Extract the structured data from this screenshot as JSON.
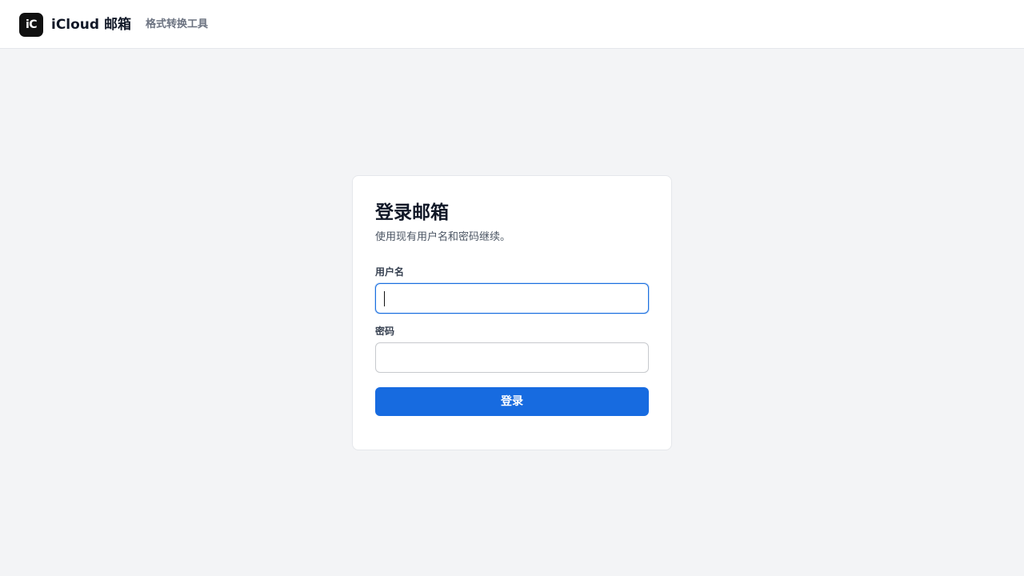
{
  "header": {
    "logo_text": "iC",
    "app_title": "iCloud 邮箱",
    "nav_link": "格式转换工具"
  },
  "login": {
    "title": "登录邮箱",
    "subtitle": "使用现有用户名和密码继续。",
    "username_label": "用户名",
    "username_value": "",
    "password_label": "密码",
    "password_value": "",
    "submit_label": "登录"
  },
  "colors": {
    "page_background": "#f3f4f6",
    "accent": "#176be0",
    "logo_background": "#111111"
  }
}
